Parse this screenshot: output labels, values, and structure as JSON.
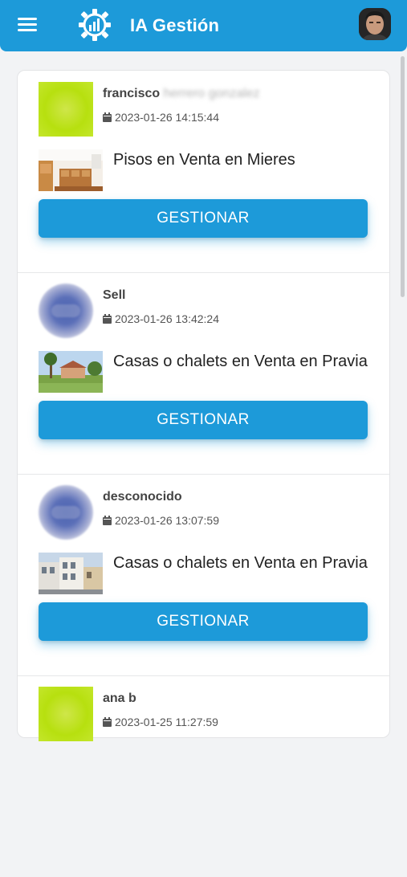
{
  "header": {
    "title": "IA Gestión",
    "menu_icon": "hamburger-menu-icon",
    "logo_icon": "gear-chart-logo-icon",
    "accent_color": "#1d9ad9"
  },
  "cards": [
    {
      "user_first": "francisco",
      "user_rest": "herrero gonzalez",
      "date": "2023-01-26 14:15:44",
      "title": "Pisos en Venta en Mieres",
      "button": "GESTIONAR"
    },
    {
      "user_first": "Sell",
      "user_rest": "",
      "date": "2023-01-26 13:42:24",
      "title": "Casas o chalets en Venta en Pravia",
      "button": "GESTIONAR"
    },
    {
      "user_first": "desconocido",
      "user_rest": "",
      "date": "2023-01-26 13:07:59",
      "title": "Casas o chalets en Venta en Pravia",
      "button": "GESTIONAR"
    },
    {
      "user_first": "ana b",
      "user_rest": "",
      "date": "2023-01-25 11:27:59"
    }
  ]
}
